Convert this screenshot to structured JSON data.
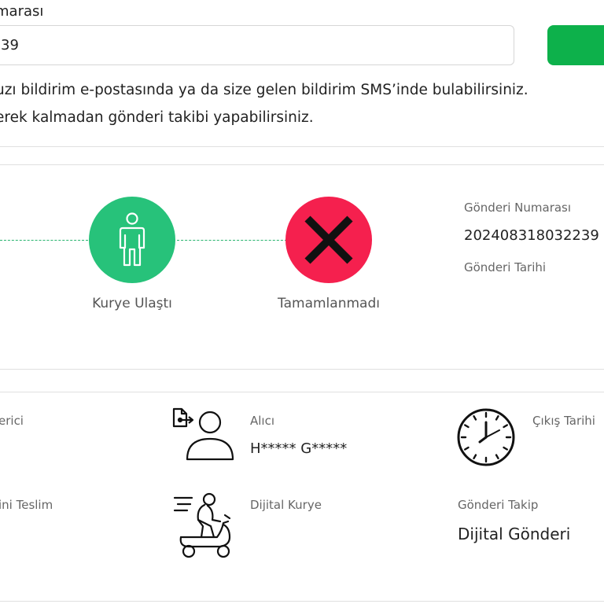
{
  "search": {
    "label": "marası",
    "value": "39"
  },
  "info": {
    "line1": "uzı bildirim e-postasında ya da size gelen bildirim SMS’inde bulabilirsiniz.",
    "line2": "erek kalmadan gönderi takibi yapabilirsiniz."
  },
  "tracking": {
    "steps": [
      {
        "label": "Kurye Ulaştı",
        "color": "#27c27a",
        "icon": "person-icon"
      },
      {
        "label": "Tamamlanmadı",
        "color": "#f5204e",
        "icon": "x-icon"
      }
    ],
    "number_label": "Gönderi Numarası",
    "number_value": "202408318032239",
    "date_label": "Gönderi Tarihi"
  },
  "details": {
    "sender_label": "erici",
    "recipient_label": "Alıcı",
    "recipient_value": "H***** G*****",
    "departure_label": "Çıkış Tarihi",
    "delivery_label": "ini Teslim",
    "courier_label": "Dijital Kurye",
    "tracking_label": "Gönderi Takip",
    "tracking_value": "Dijital Gönderi"
  },
  "colors": {
    "accent_green": "#0db14b",
    "step_green": "#27c27a",
    "step_red": "#f5204e"
  }
}
